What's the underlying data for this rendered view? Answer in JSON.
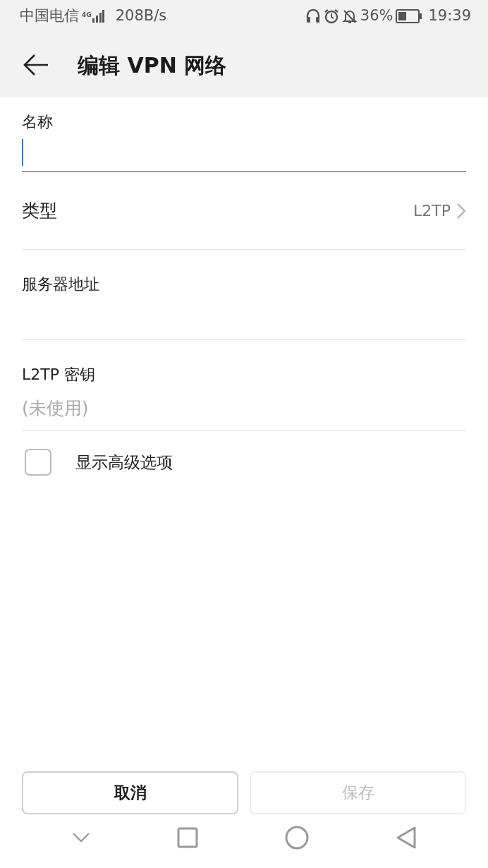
{
  "status_bar": {
    "carrier": "中国电信",
    "network_type": "4G",
    "speed": "208B/s",
    "battery_percent": "36%",
    "time": "19:39"
  },
  "header": {
    "title": "编辑 VPN 网络"
  },
  "fields": [
    {
      "kind": "text",
      "label": "名称",
      "focused": true
    },
    {
      "kind": "select",
      "label": "类型",
      "value": "L2TP"
    },
    {
      "kind": "text",
      "label": "服务器地址",
      "focused": false
    },
    {
      "kind": "text",
      "label": "L2TP 密钥",
      "placeholder": "(未使用)",
      "focused": false
    }
  ],
  "advanced_option": {
    "label": "显示高级选项",
    "checked": false
  },
  "buttons": [
    {
      "label": "取消",
      "disabled": false
    },
    {
      "label": "保存",
      "disabled": true
    }
  ]
}
